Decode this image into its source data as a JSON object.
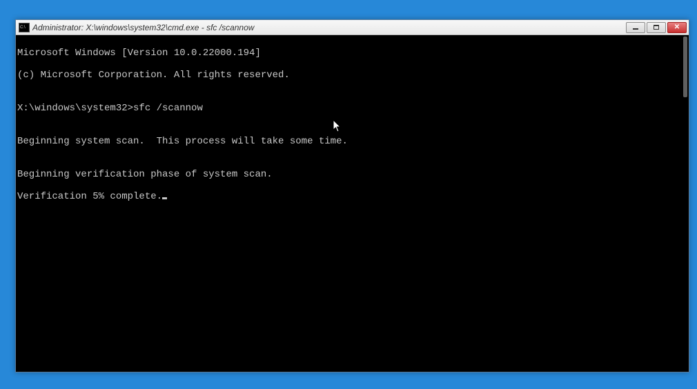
{
  "window": {
    "title": "Administrator: X:\\windows\\system32\\cmd.exe - sfc  /scannow",
    "icon_label": "C:\\"
  },
  "console": {
    "lines": [
      "Microsoft Windows [Version 10.0.22000.194]",
      "(c) Microsoft Corporation. All rights reserved.",
      "",
      "X:\\windows\\system32>sfc /scannow",
      "",
      "Beginning system scan.  This process will take some time.",
      "",
      "Beginning verification phase of system scan.",
      "Verification 5% complete."
    ]
  }
}
